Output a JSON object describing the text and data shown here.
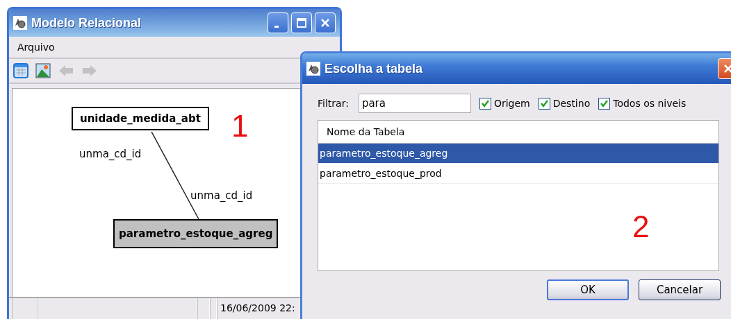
{
  "main_window": {
    "title": "Modelo Relacional",
    "menu": [
      "Arquivo"
    ],
    "toolbar": [
      {
        "kind": "table",
        "disabled": false
      },
      {
        "kind": "image",
        "disabled": false
      },
      {
        "kind": "back",
        "disabled": true
      },
      {
        "kind": "forward",
        "disabled": true
      }
    ],
    "diagram": {
      "nodes": [
        {
          "name": "unidade_medida_abt",
          "selected": false
        },
        {
          "name": "parametro_estoque_agreg",
          "selected": true
        }
      ],
      "edge_labels": [
        "unma_cd_id",
        "unma_cd_id"
      ]
    },
    "status_bar": [
      "16/06/2009 22:"
    ]
  },
  "annotations": [
    "1",
    "2"
  ],
  "dialog": {
    "title": "Escolha a tabela",
    "filter_label": "Filtrar:",
    "filter_value": "para",
    "checkboxes": [
      {
        "label": "Origem",
        "checked": true
      },
      {
        "label": "Destino",
        "checked": true
      },
      {
        "label": "Todos os niveis",
        "checked": true
      }
    ],
    "table": {
      "columns": [
        "Nome da Tabela"
      ],
      "rows": [
        {
          "name": "parametro_estoque_agreg",
          "selected": true
        },
        {
          "name": "parametro_estoque_prod",
          "selected": false
        }
      ]
    },
    "buttons": [
      {
        "label": "OK",
        "default": true
      },
      {
        "label": "Cancelar",
        "default": false
      }
    ]
  }
}
